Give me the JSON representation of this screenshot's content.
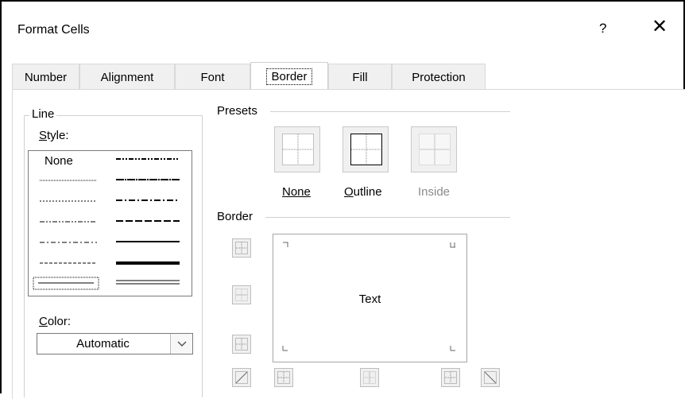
{
  "dialog": {
    "title": "Format Cells",
    "help_label": "?",
    "close_label": "✕"
  },
  "tabs": [
    {
      "label": "Number"
    },
    {
      "label": "Alignment"
    },
    {
      "label": "Font"
    },
    {
      "label": "Border"
    },
    {
      "label": "Fill"
    },
    {
      "label": "Protection"
    }
  ],
  "active_tab": "Border",
  "line": {
    "group_title": "Line",
    "style_label": "Style:",
    "style_none_label": "None",
    "color_label": "Color:",
    "color_value": "Automatic"
  },
  "presets": {
    "group_title": "Presets",
    "items": [
      {
        "label": "None",
        "enabled": true
      },
      {
        "label": "Outline",
        "enabled": true
      },
      {
        "label": "Inside",
        "enabled": false
      }
    ]
  },
  "border": {
    "group_title": "Border",
    "preview_text": "Text"
  },
  "colors": {
    "disabled_text": "#8a8a8a",
    "button_face": "#f0f0f0"
  }
}
